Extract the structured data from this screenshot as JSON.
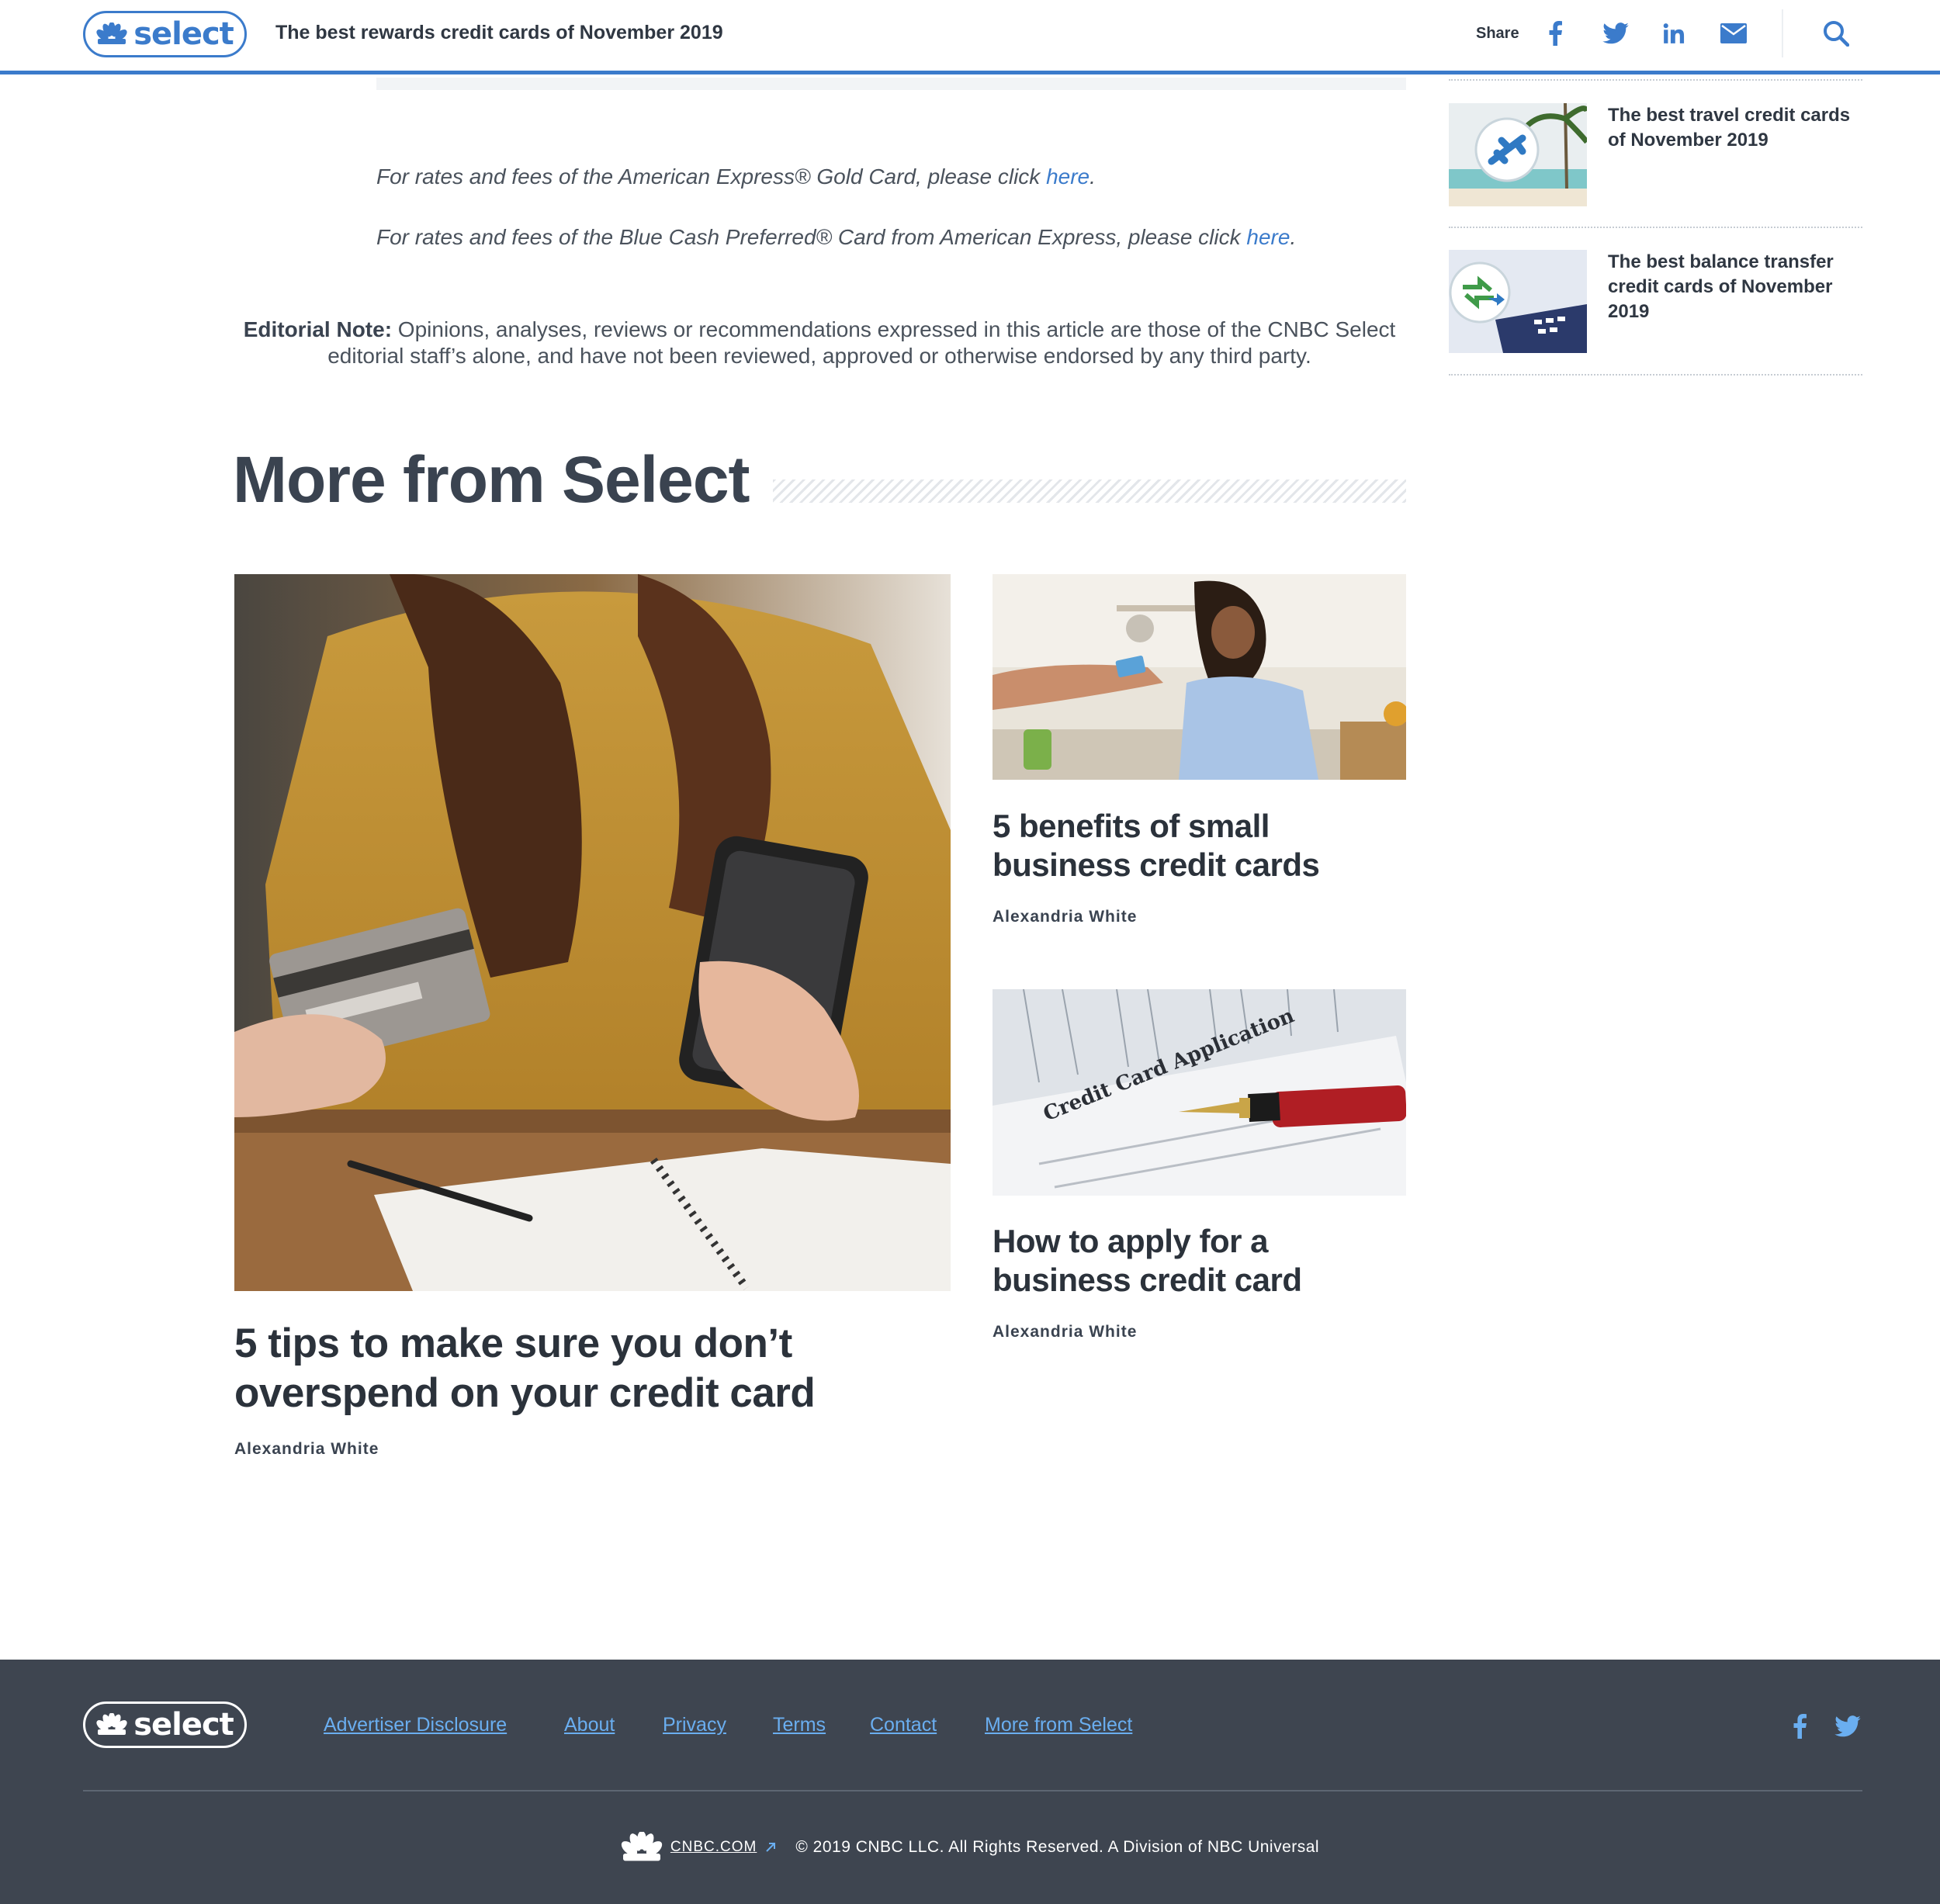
{
  "header": {
    "logo_text": "select",
    "title": "The best rewards credit cards of November 2019",
    "share_label": "Share",
    "icons": [
      "facebook-icon",
      "twitter-icon",
      "linkedin-icon",
      "email-icon",
      "search-icon"
    ]
  },
  "rates": [
    {
      "prefix": "For rates and fees of the American Express® Gold Card, please click ",
      "link": "here",
      "suffix": "."
    },
    {
      "prefix": "For rates and fees of the Blue Cash Preferred® Card from American Express, please click ",
      "link": "here",
      "suffix": "."
    }
  ],
  "editorial": {
    "label": "Editorial Note:",
    "text": " Opinions, analyses, reviews or recommendations expressed in this article are those of the CNBC Select editorial staff’s alone, and have not been reviewed, approved or otherwise endorsed by any third party."
  },
  "more": {
    "heading": "More from Select",
    "main": {
      "title": "5 tips to make sure you don’t overspend on your credit card",
      "author": "Alexandria White"
    },
    "side": [
      {
        "title": "5 benefits of small business credit cards",
        "author": "Alexandria White"
      },
      {
        "title": "How to apply for a business credit card",
        "author": "Alexandria White",
        "image_text": "Credit Card Application"
      }
    ]
  },
  "sidebar": {
    "items": [
      {
        "title": "The best travel credit cards of November 2019"
      },
      {
        "title": "The best balance transfer credit cards of November 2019"
      }
    ]
  },
  "footer": {
    "logo_text": "select",
    "links": [
      "Advertiser Disclosure",
      "About",
      "Privacy",
      "Terms",
      "Contact",
      "More from Select"
    ],
    "cnbc_link": "CNBC.COM",
    "copyright": "© 2019 CNBC LLC. All Rights Reserved. A Division of NBC Universal"
  },
  "colors": {
    "accent": "#3b7bcb",
    "footer_bg": "#3e4550",
    "footer_link": "#6aaef0",
    "text": "#3a4350"
  }
}
